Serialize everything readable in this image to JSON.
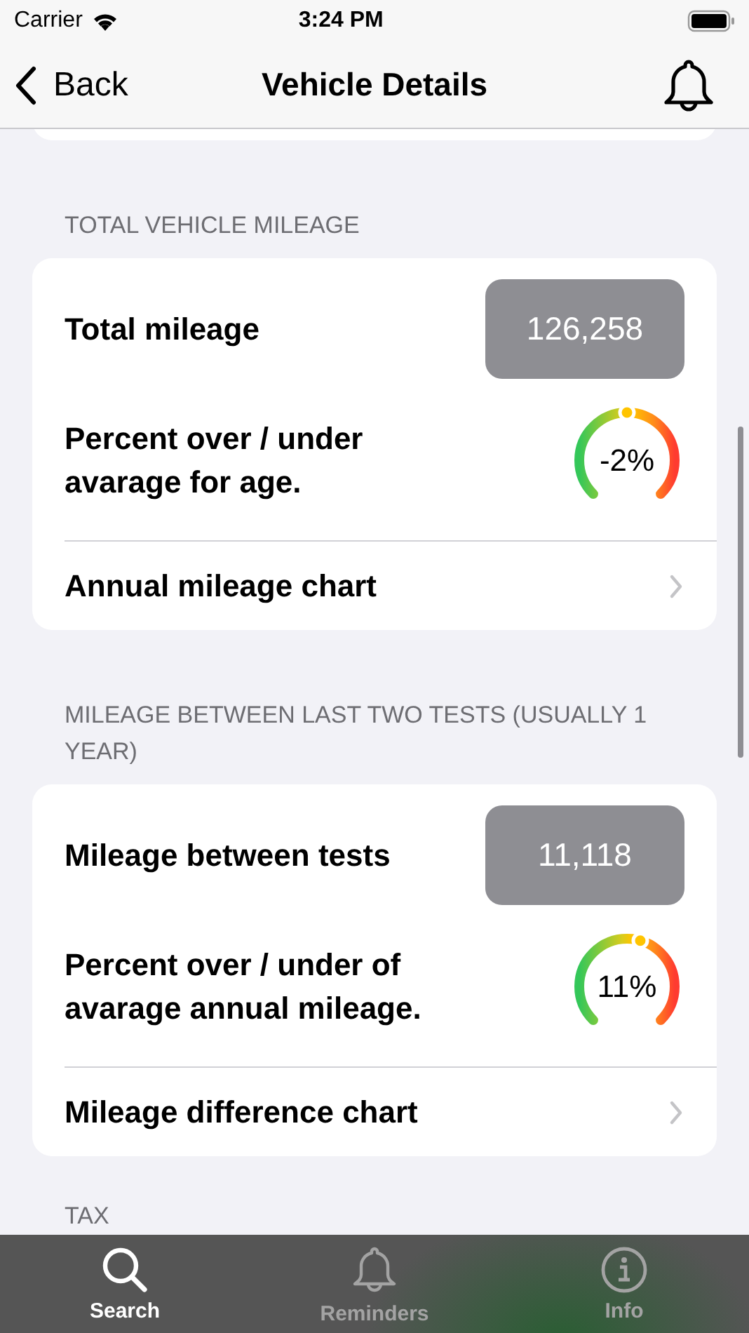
{
  "status_bar": {
    "carrier": "Carrier",
    "time": "3:24 PM"
  },
  "nav": {
    "back": "Back",
    "title": "Vehicle Details"
  },
  "sections": [
    {
      "header": "TOTAL VEHICLE MILEAGE",
      "rows": [
        {
          "kind": "value",
          "label": "Total mileage",
          "value": "126,258"
        },
        {
          "kind": "gauge",
          "label": "Percent over / under avarage for age.",
          "reading": "-2%",
          "level": 0.5
        },
        {
          "kind": "link",
          "label": "Annual mileage chart"
        }
      ]
    },
    {
      "header": "MILEAGE BETWEEN LAST TWO TESTS (USUALLY 1 YEAR)",
      "rows": [
        {
          "kind": "value",
          "label": "Mileage between tests",
          "value": "11,118"
        },
        {
          "kind": "gauge",
          "label": "Percent over / under of avarage annual mileage.",
          "reading": "11%",
          "level": 0.56
        },
        {
          "kind": "link",
          "label": "Mileage difference chart"
        }
      ]
    },
    {
      "header": "TAX"
    }
  ],
  "tab_bar": [
    {
      "kind": "search",
      "label": "Search",
      "selected": true
    },
    {
      "kind": "bell",
      "label": "Reminders",
      "selected": false
    },
    {
      "kind": "info",
      "label": "Info",
      "selected": false
    }
  ]
}
